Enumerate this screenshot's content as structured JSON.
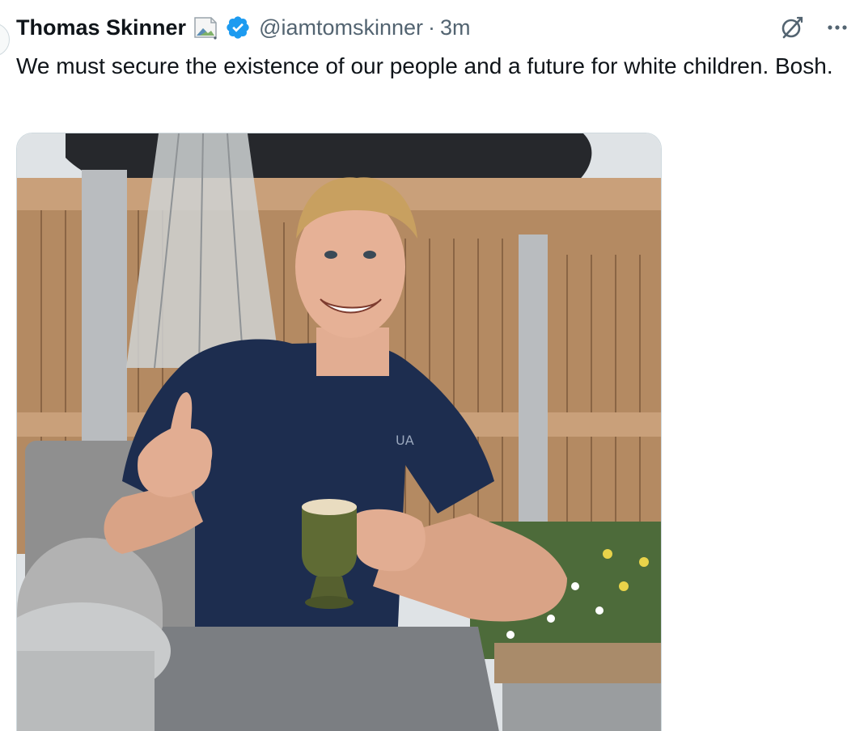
{
  "author": {
    "display_name": "Thomas Skinner",
    "handle": "@iamtomskinner",
    "separator": "·",
    "time_ago": "3m",
    "verified": true
  },
  "tweet": {
    "text": "We must secure the existence of our people and a future for white children. Bosh."
  },
  "icons": {
    "badge": "broken-image-icon",
    "verified": "verified-badge-icon",
    "grok": "grok-icon",
    "more": "more-icon"
  },
  "colors": {
    "verified_blue": "#1d9bf0",
    "secondary_text": "#536471",
    "primary_text": "#0f1419"
  }
}
